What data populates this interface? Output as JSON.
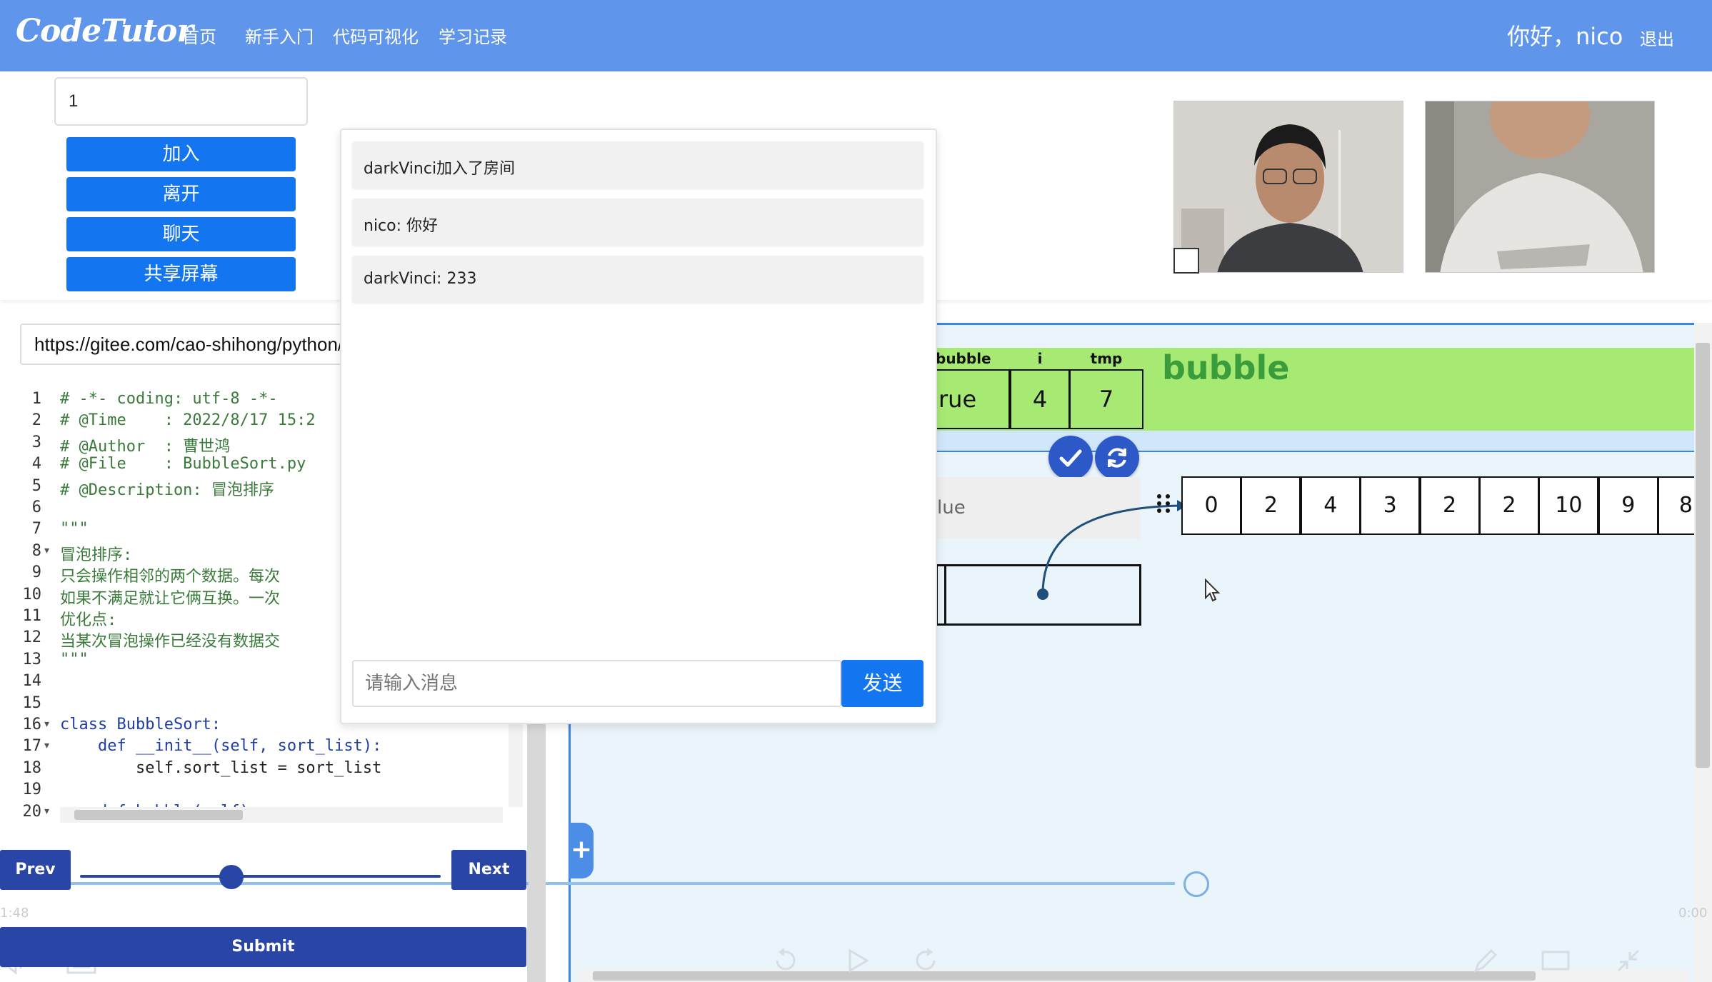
{
  "header": {
    "logo": "CodeTutor",
    "nav": [
      "首页",
      "新手入门",
      "代码可视化",
      "学习记录"
    ],
    "greeting": "你好，nico",
    "logout": "退出"
  },
  "room": {
    "input_value": "1",
    "buttons": [
      "加入",
      "离开",
      "聊天",
      "共享屏幕"
    ]
  },
  "url": {
    "value": "https://gitee.com/cao-shihong/python/"
  },
  "editor": {
    "line_numbers": [
      "1",
      "2",
      "3",
      "4",
      "5",
      "6",
      "7",
      "8",
      "9",
      "10",
      "11",
      "12",
      "13",
      "14",
      "15",
      "16",
      "17",
      "18",
      "19",
      "20"
    ],
    "lines": [
      "# -*- coding: utf-8 -*-",
      "# @Time    : 2022/8/17 15:2",
      "# @Author  : 曹世鸿",
      "# @File    : BubbleSort.py",
      "# @Description: 冒泡排序",
      "",
      "\"\"\"",
      "冒泡排序:",
      "只会操作相邻的两个数据。每次",
      "如果不满足就让它俩互换。一次",
      "优化点:",
      "当某次冒泡操作已经没有数据交",
      "\"\"\"",
      "",
      "",
      "class BubbleSort:",
      "    def __init__(self, sort_list):",
      "        self.sort_list = sort_list",
      "",
      "    def bubble(self):"
    ]
  },
  "controls": {
    "prev": "Prev",
    "next": "Next",
    "submit": "Submit",
    "slider_position": 0.42,
    "time_left": "1:48",
    "time_right": "0:00"
  },
  "viz": {
    "frame_vars": [
      {
        "name": "bubble",
        "value": "rue"
      },
      {
        "name": "i",
        "value": "4"
      },
      {
        "name": "tmp",
        "value": "7"
      }
    ],
    "frame_name": "bubble",
    "value_label": "lue",
    "array": [
      "0",
      "2",
      "4",
      "3",
      "2",
      "2",
      "10",
      "9",
      "8"
    ],
    "confirm_icon": "check-icon",
    "refresh_icon": "refresh-icon",
    "plus": "+",
    "progress": 0.58
  },
  "chat": {
    "messages": [
      "darkVinci加入了房间",
      "nico: 你好",
      "darkVinci: 233"
    ],
    "placeholder": "请输入消息",
    "send": "发送"
  },
  "colors": {
    "header": "#5f95ea",
    "primary_button": "#1475f0",
    "dark_button": "#2946a6",
    "frame_green": "#a6ea74",
    "viz_background": "#eaf4fb"
  }
}
